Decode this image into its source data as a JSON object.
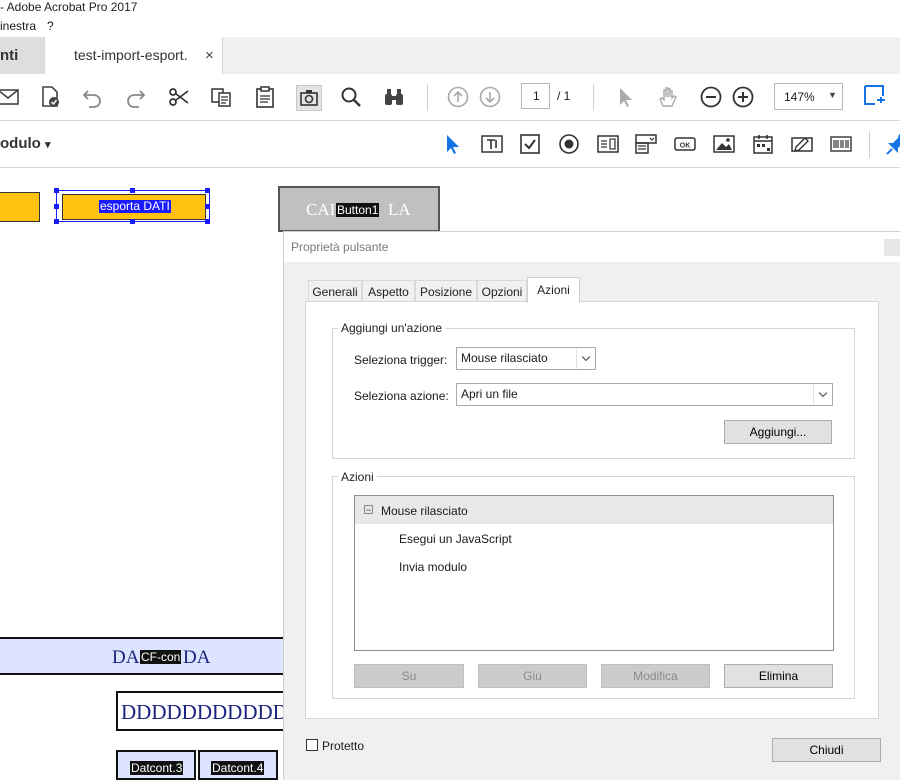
{
  "app": {
    "title": "- Adobe Acrobat Pro 2017"
  },
  "menubar": {
    "items": [
      "inestra",
      "?"
    ]
  },
  "tabs": {
    "left_label": "nti",
    "active_label": "test-import-esport.",
    "close_glyph": "×"
  },
  "toolbar1": {
    "page_current": "1",
    "page_total": "/ 1",
    "zoom": "147%"
  },
  "toolbar2": {
    "form_menu_label": "odulo",
    "form_menu_caret": "▾"
  },
  "document": {
    "selected_field_label": "esporta DATI",
    "field_caption_button": "CAI",
    "field_caption_button_end": "LA",
    "field_name_button": "Button1",
    "field_da_left": "DA",
    "field_da_right": "DA",
    "field_name_cf": "CF-con",
    "field_d_text": "DDDDDDDDDDD",
    "field_datcont3": "Datcont.3",
    "field_datcont4": "Datcont.4"
  },
  "dialog": {
    "title": "Proprietà pulsante",
    "tabs": [
      "Generali",
      "Aspetto",
      "Posizione",
      "Opzioni",
      "Azioni"
    ],
    "active_tab": "Azioni",
    "add_action": {
      "group_label": "Aggiungi un'azione",
      "trigger_label": "Seleziona trigger:",
      "trigger_value": "Mouse rilasciato",
      "action_label": "Seleziona azione:",
      "action_value": "Apri un file",
      "add_button": "Aggiungi..."
    },
    "actions": {
      "group_label": "Azioni",
      "tree_root": "Mouse rilasciato",
      "tree_expander": "−",
      "tree_children": [
        "Esegui un JavaScript",
        "Invia modulo"
      ],
      "btn_up": "Su",
      "btn_down": "Giù",
      "btn_edit": "Modifica",
      "btn_delete": "Elimina"
    },
    "protected_label": "Protetto",
    "close_button": "Chiudi"
  },
  "colors": {
    "accent_blue": "#1473e6",
    "field_yellow": "#ffc20e",
    "selection_blue": "#1a1aff"
  }
}
